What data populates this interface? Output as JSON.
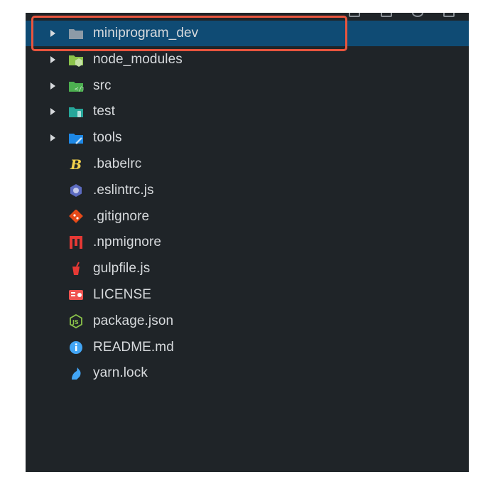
{
  "explorer": {
    "highlight_color": "#e8553e",
    "selection_color": "#0f4b74",
    "items": [
      {
        "label": "miniprogram_dev",
        "kind": "folder",
        "icon": "folder-icon",
        "color": "#8d9ba7",
        "selected": true
      },
      {
        "label": "node_modules",
        "kind": "folder",
        "icon": "folder-node-icon",
        "color": "#8bc34a"
      },
      {
        "label": "src",
        "kind": "folder",
        "icon": "folder-src-icon",
        "color": "#4caf50"
      },
      {
        "label": "test",
        "kind": "folder",
        "icon": "folder-test-icon",
        "color": "#26a69a"
      },
      {
        "label": "tools",
        "kind": "folder",
        "icon": "folder-tools-icon",
        "color": "#1e88e5"
      },
      {
        "label": ".babelrc",
        "kind": "file",
        "icon": "babel-icon",
        "color": "#f2d14c"
      },
      {
        "label": ".eslintrc.js",
        "kind": "file",
        "icon": "eslint-icon",
        "color": "#5c6bc0"
      },
      {
        "label": ".gitignore",
        "kind": "file",
        "icon": "git-icon",
        "color": "#e64a19"
      },
      {
        "label": ".npmignore",
        "kind": "file",
        "icon": "npm-icon",
        "color": "#e53935"
      },
      {
        "label": "gulpfile.js",
        "kind": "file",
        "icon": "gulp-icon",
        "color": "#e53935"
      },
      {
        "label": "LICENSE",
        "kind": "file",
        "icon": "license-icon",
        "color": "#ef5350"
      },
      {
        "label": "package.json",
        "kind": "file",
        "icon": "nodejs-icon",
        "color": "#8bc34a"
      },
      {
        "label": "README.md",
        "kind": "file",
        "icon": "info-icon",
        "color": "#42a5f5"
      },
      {
        "label": "yarn.lock",
        "kind": "file",
        "icon": "yarn-icon",
        "color": "#42a5f5"
      }
    ]
  }
}
